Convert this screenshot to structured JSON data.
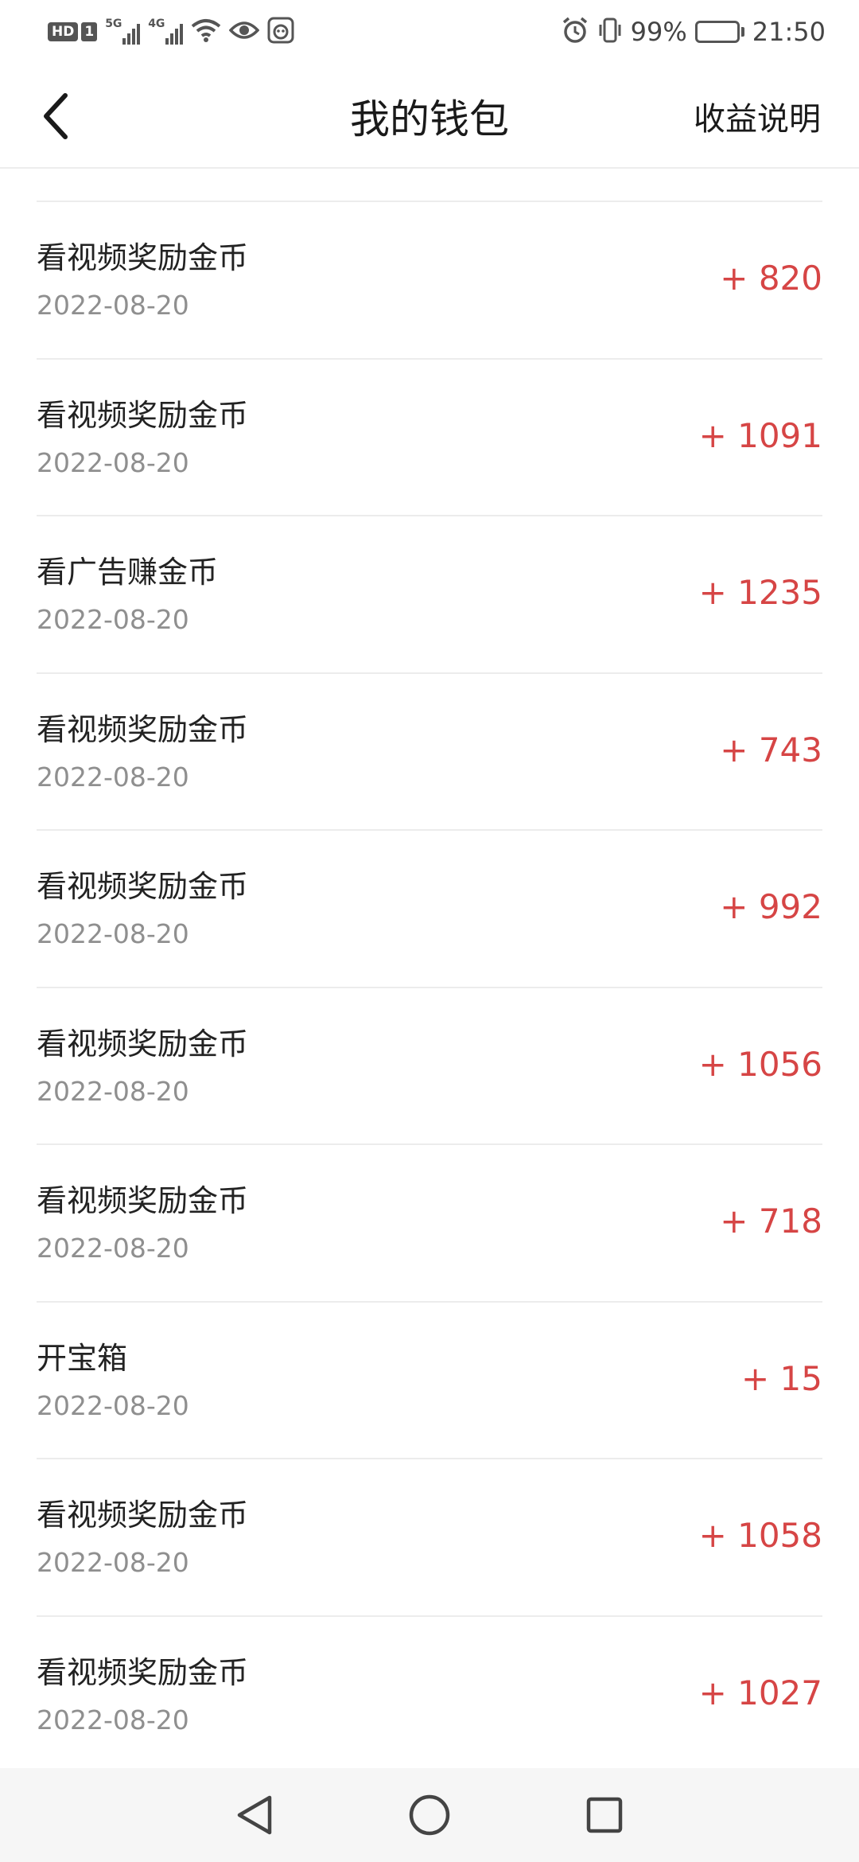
{
  "status_bar": {
    "hd_label": "HD",
    "sim_label": "1",
    "signal1_tag": "5G",
    "signal2_tag": "4G",
    "battery_percent": "99%",
    "time": "21:50"
  },
  "header": {
    "title": "我的钱包",
    "help_label": "收益说明"
  },
  "transactions": [
    {
      "name": "看视频奖励金币",
      "date": "2022-08-20",
      "amount": "+ 820"
    },
    {
      "name": "看视频奖励金币",
      "date": "2022-08-20",
      "amount": "+ 1091"
    },
    {
      "name": "看广告赚金币",
      "date": "2022-08-20",
      "amount": "+ 1235"
    },
    {
      "name": "看视频奖励金币",
      "date": "2022-08-20",
      "amount": "+ 743"
    },
    {
      "name": "看视频奖励金币",
      "date": "2022-08-20",
      "amount": "+ 992"
    },
    {
      "name": "看视频奖励金币",
      "date": "2022-08-20",
      "amount": "+ 1056"
    },
    {
      "name": "看视频奖励金币",
      "date": "2022-08-20",
      "amount": "+ 718"
    },
    {
      "name": "开宝箱",
      "date": "2022-08-20",
      "amount": "+ 15"
    },
    {
      "name": "看视频奖励金币",
      "date": "2022-08-20",
      "amount": "+ 1058"
    },
    {
      "name": "看视频奖励金币",
      "date": "2022-08-20",
      "amount": "+ 1027"
    }
  ],
  "colors": {
    "amount_red": "#d64545",
    "date_gray": "#8f8f8f",
    "divider": "#ececec"
  }
}
